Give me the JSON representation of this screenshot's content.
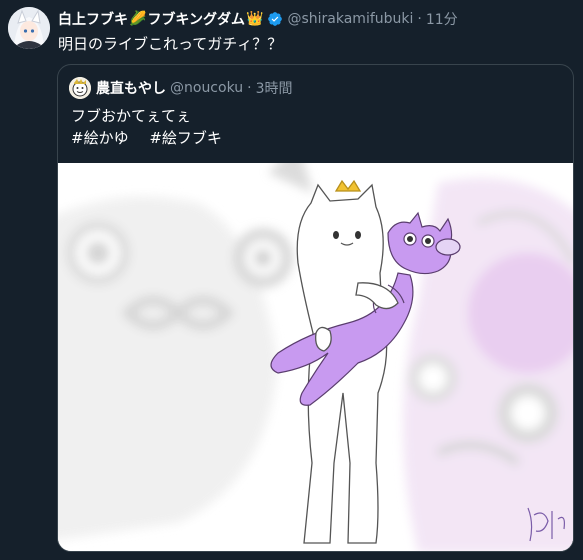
{
  "tweet": {
    "display_name_part1": "白上フブキ",
    "display_name_emoji1": "🌽",
    "display_name_part2": "フブキングダム",
    "display_name_emoji2": "👑",
    "handle": "@shirakamifubuki",
    "separator": "·",
    "time": "11分",
    "text": "明日のライブこれってガチィ？？",
    "verified_color": "#1d9bf0"
  },
  "quote": {
    "display_name": "農直もやし",
    "handle": "@noucoku",
    "separator": "·",
    "time": "3時間",
    "line1": "フブおかてぇてぇ",
    "hashtags": [
      "#絵かゆ",
      "#絵フブキ"
    ],
    "media_signature": "もやし"
  },
  "colors": {
    "background": "#15202b",
    "border": "#38444d",
    "muted": "#8b98a5",
    "character_purple": "#c89af0"
  }
}
